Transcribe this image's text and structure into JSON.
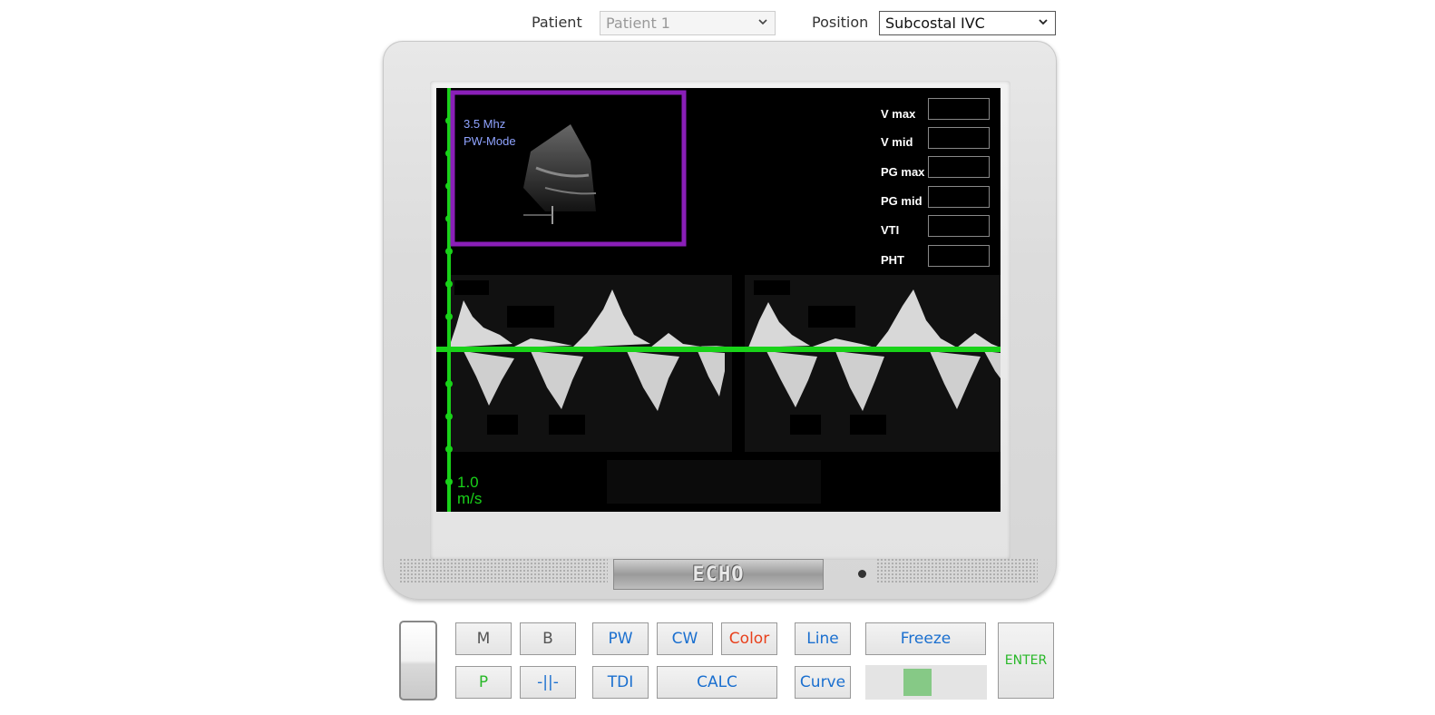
{
  "header": {
    "patient_label": "Patient",
    "patient_value": "Patient 1",
    "position_label": "Position",
    "position_value": "Subcostal IVC"
  },
  "screen": {
    "probe_freq": "3.5 Mhz",
    "mode": "PW-Mode",
    "scale_value": "1.0",
    "scale_unit": "m/s",
    "measurements": [
      {
        "label": "V max",
        "value": ""
      },
      {
        "label": "V mid",
        "value": ""
      },
      {
        "label": "PG max",
        "value": ""
      },
      {
        "label": "PG mid",
        "value": ""
      },
      {
        "label": "VTI",
        "value": ""
      },
      {
        "label": "PHT",
        "value": ""
      }
    ],
    "colors": {
      "trace": "#19d219",
      "roi": "#8a1fb8",
      "mode_text": "#8fa3ff"
    }
  },
  "brand": "ECHO",
  "controls": {
    "m": "M",
    "b": "B",
    "pw": "PW",
    "cw": "CW",
    "color": "Color",
    "line": "Line",
    "freeze": "Freeze",
    "enter": "ENTER",
    "p": "P",
    "caliper": "-||-",
    "tdi": "TDI",
    "calc": "CALC",
    "curve": "Curve"
  }
}
